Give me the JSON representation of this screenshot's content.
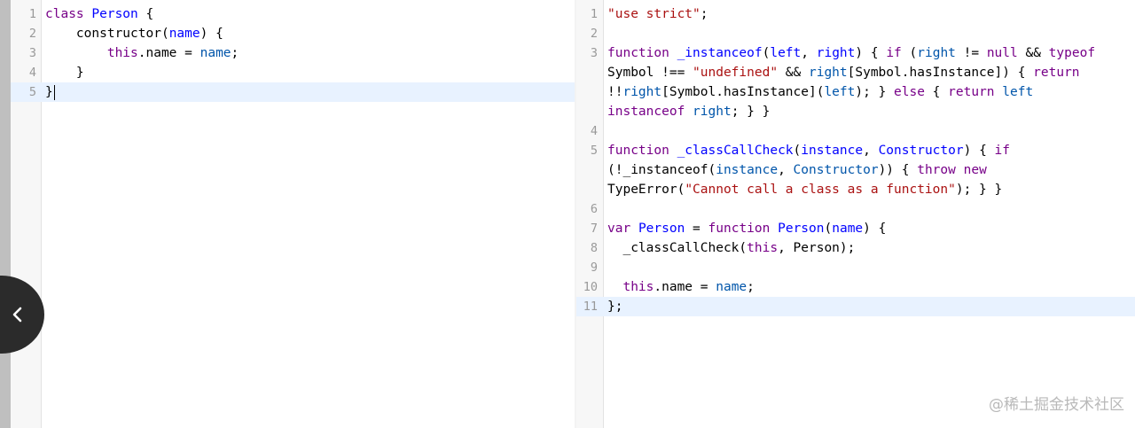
{
  "left_editor": {
    "lines": [
      {
        "n": "1",
        "tokens": [
          {
            "t": "class",
            "c": "k"
          },
          {
            "t": " "
          },
          {
            "t": "Person",
            "c": "d"
          },
          {
            "t": " {"
          }
        ]
      },
      {
        "n": "2",
        "tokens": [
          {
            "t": "    constructor("
          },
          {
            "t": "name",
            "c": "d"
          },
          {
            "t": ") {"
          }
        ]
      },
      {
        "n": "3",
        "tokens": [
          {
            "t": "        "
          },
          {
            "t": "this",
            "c": "k"
          },
          {
            "t": ".name = "
          },
          {
            "t": "name",
            "c": "v"
          },
          {
            "t": ";"
          }
        ]
      },
      {
        "n": "4",
        "tokens": [
          {
            "t": "    }"
          }
        ]
      },
      {
        "n": "5",
        "active": true,
        "cursor": true,
        "tokens": [
          {
            "t": "}"
          }
        ]
      }
    ]
  },
  "right_editor": {
    "lines": [
      {
        "n": "1",
        "tokens": [
          {
            "t": "\"use strict\"",
            "c": "s"
          },
          {
            "t": ";"
          }
        ]
      },
      {
        "n": "2",
        "tokens": []
      },
      {
        "n": "3",
        "tokens": [
          {
            "t": "function",
            "c": "k"
          },
          {
            "t": " "
          },
          {
            "t": "_instanceof",
            "c": "d"
          },
          {
            "t": "("
          },
          {
            "t": "left",
            "c": "d"
          },
          {
            "t": ", "
          },
          {
            "t": "right",
            "c": "d"
          },
          {
            "t": ") { "
          },
          {
            "t": "if",
            "c": "k"
          },
          {
            "t": " ("
          },
          {
            "t": "right",
            "c": "v"
          },
          {
            "t": " != "
          },
          {
            "t": "null",
            "c": "k"
          },
          {
            "t": " && "
          },
          {
            "t": "typeof",
            "c": "k"
          }
        ]
      },
      {
        "n": "",
        "tokens": [
          {
            "t": "Symbol !== "
          },
          {
            "t": "\"undefined\"",
            "c": "s"
          },
          {
            "t": " && "
          },
          {
            "t": "right",
            "c": "v"
          },
          {
            "t": "[Symbol.hasInstance]) { "
          },
          {
            "t": "return",
            "c": "k"
          }
        ]
      },
      {
        "n": "",
        "tokens": [
          {
            "t": "!!"
          },
          {
            "t": "right",
            "c": "v"
          },
          {
            "t": "[Symbol.hasInstance]("
          },
          {
            "t": "left",
            "c": "v"
          },
          {
            "t": "); } "
          },
          {
            "t": "else",
            "c": "k"
          },
          {
            "t": " { "
          },
          {
            "t": "return",
            "c": "k"
          },
          {
            "t": " "
          },
          {
            "t": "left",
            "c": "v"
          }
        ]
      },
      {
        "n": "",
        "tokens": [
          {
            "t": "instanceof",
            "c": "k"
          },
          {
            "t": " "
          },
          {
            "t": "right",
            "c": "v"
          },
          {
            "t": "; } }"
          }
        ]
      },
      {
        "n": "4",
        "tokens": []
      },
      {
        "n": "5",
        "tokens": [
          {
            "t": "function",
            "c": "k"
          },
          {
            "t": " "
          },
          {
            "t": "_classCallCheck",
            "c": "d"
          },
          {
            "t": "("
          },
          {
            "t": "instance",
            "c": "d"
          },
          {
            "t": ", "
          },
          {
            "t": "Constructor",
            "c": "d"
          },
          {
            "t": ") { "
          },
          {
            "t": "if",
            "c": "k"
          }
        ]
      },
      {
        "n": "",
        "tokens": [
          {
            "t": "(!_instanceof("
          },
          {
            "t": "instance",
            "c": "v"
          },
          {
            "t": ", "
          },
          {
            "t": "Constructor",
            "c": "v"
          },
          {
            "t": ")) { "
          },
          {
            "t": "throw",
            "c": "k"
          },
          {
            "t": " "
          },
          {
            "t": "new",
            "c": "k"
          }
        ]
      },
      {
        "n": "",
        "tokens": [
          {
            "t": "TypeError("
          },
          {
            "t": "\"Cannot call a class as a function\"",
            "c": "s"
          },
          {
            "t": "); } }"
          }
        ]
      },
      {
        "n": "6",
        "tokens": []
      },
      {
        "n": "7",
        "tokens": [
          {
            "t": "var",
            "c": "k"
          },
          {
            "t": " "
          },
          {
            "t": "Person",
            "c": "d"
          },
          {
            "t": " = "
          },
          {
            "t": "function",
            "c": "k"
          },
          {
            "t": " "
          },
          {
            "t": "Person",
            "c": "d"
          },
          {
            "t": "("
          },
          {
            "t": "name",
            "c": "d"
          },
          {
            "t": ") {"
          }
        ]
      },
      {
        "n": "8",
        "tokens": [
          {
            "t": "  _classCallCheck("
          },
          {
            "t": "this",
            "c": "k"
          },
          {
            "t": ", Person);"
          }
        ]
      },
      {
        "n": "9",
        "tokens": []
      },
      {
        "n": "10",
        "tokens": [
          {
            "t": "  "
          },
          {
            "t": "this",
            "c": "k"
          },
          {
            "t": ".name = "
          },
          {
            "t": "name",
            "c": "v"
          },
          {
            "t": ";"
          }
        ]
      },
      {
        "n": "11",
        "active": true,
        "tokens": [
          {
            "t": "};"
          }
        ]
      }
    ]
  },
  "collapse_button": {
    "icon": "chevron-left-icon"
  },
  "watermark": {
    "text": "@稀土掘金技术社区"
  }
}
